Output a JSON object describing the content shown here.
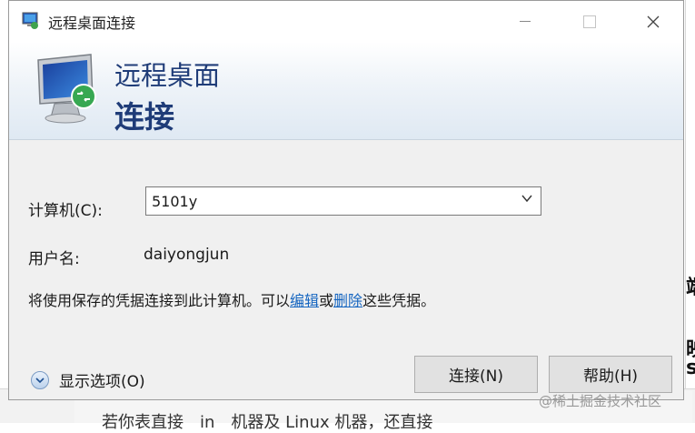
{
  "window": {
    "title": "远程桌面连接",
    "controls": [
      "minimize-icon",
      "maximize-icon",
      "close-icon"
    ]
  },
  "banner": {
    "line1": "远程桌面",
    "line2": "连接",
    "icon": "remote-desktop-monitor-icon"
  },
  "form": {
    "computer_label": "计算机(C):",
    "computer_value": "5101y",
    "username_label": "用户名:",
    "username_value": "daiyongjun",
    "info_prefix": "将使用保存的凭据连接到此计算机。可以",
    "edit_link": "编辑",
    "info_or": "或",
    "delete_link": "删除",
    "info_suffix": "这些凭据。"
  },
  "footer": {
    "show_options_label": "显示选项(O)",
    "connect_button": "连接(N)",
    "help_button": "帮助(H)"
  },
  "watermark": "@稀土掘金技术社区",
  "background": {
    "right_glyphs": [
      "端",
      "映",
      "sh"
    ],
    "bottom_text": "若你表直接　in　机器及 Linux 机器，还直接"
  }
}
